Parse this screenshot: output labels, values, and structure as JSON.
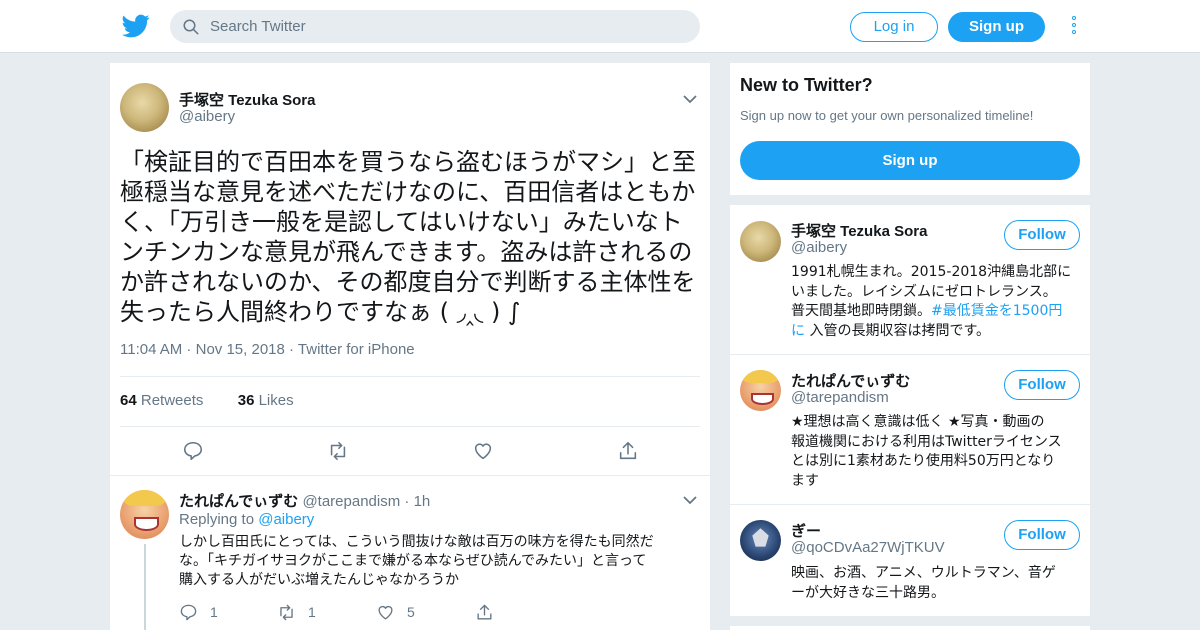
{
  "header": {
    "search_placeholder": "Search Twitter",
    "login_label": "Log in",
    "signup_label": "Sign up",
    "brand_color": "#1da1f2"
  },
  "tweet": {
    "author_name": "手塚空 Tezuka Sora",
    "author_handle": "@aibery",
    "text_lines": [
      "「検証目的で百田本を買うなら盗むほうがマシ」と至",
      "極穏当な意見を述べただけなのに、百田信者はともか",
      "く、「万引き一般を是認してはいけない」みたいなト",
      "ンチンカンな意見が飛んできます。盗みは許されるの",
      "か許されないのか、その都度自分で判断する主体性を",
      "失ったら人間終わりですなぁ ( ◞‸◟ ) ∫"
    ],
    "time": "11:04 AM",
    "date": "Nov 15, 2018",
    "source": "Twitter for iPhone",
    "retweets_count": "64",
    "retweets_label": "Retweets",
    "likes_count": "36",
    "likes_label": "Likes"
  },
  "reply": {
    "author_name": "たれぱんでぃずむ",
    "author_handle": "@tarepandism",
    "time_ago": "1h",
    "replying_prefix": "Replying to",
    "replying_handle": "@aibery",
    "text_lines": [
      "しかし百田氏にとっては、こういう間抜けな敵は百万の味方を得たも同然だ",
      "な。「キチガイサヨクがここまで嫌がる本ならぜひ読んでみたい」と言って",
      "購入する人がだいぶ増えたんじゃなかろうか"
    ],
    "reply_count": "1",
    "retweet_count": "1",
    "like_count": "5"
  },
  "sidebar": {
    "new_title": "New to Twitter?",
    "new_subtitle": "Sign up now to get your own personalized timeline!",
    "signup_label": "Sign up",
    "follow_label": "Follow",
    "users": [
      {
        "name": "手塚空 Tezuka Sora",
        "handle": "@aibery",
        "bio_lines": [
          "1991札幌生まれ。2015-2018沖縄島北部に",
          "いました。レイシズムにゼロトレランス。"
        ],
        "bio_line3_text": "普天間基地即時閉鎖。",
        "bio_hashtag_a": "#最低賃金を1500円",
        "bio_hashtag_b": "に",
        "bio_line4_rest": " 入管の長期収容は拷問です。"
      },
      {
        "name": "たれぱんでぃずむ",
        "handle": "@tarepandism",
        "bio_lines": [
          "★理想は高く意識は低く ★写真・動画の",
          "報道機関における利用はTwitterライセンス",
          "とは別に1素材あたり使用料50万円となり",
          "ます"
        ]
      },
      {
        "name": "ぎー",
        "handle": "@qoCDvAa27WjTKUV",
        "bio_lines": [
          "映画、お酒、アニメ、ウルトラマン、音ゲ",
          "ーが大好きな三十路男。"
        ]
      }
    ]
  }
}
